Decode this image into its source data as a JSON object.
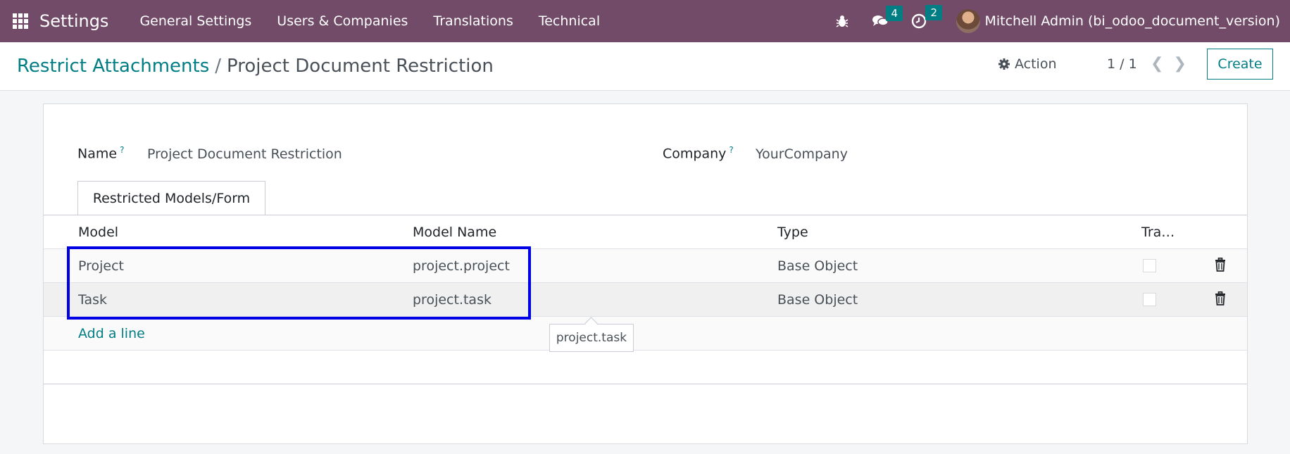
{
  "navbar": {
    "app_name": "Settings",
    "menu": [
      "General Settings",
      "Users & Companies",
      "Translations",
      "Technical"
    ],
    "messages_count": "4",
    "activities_count": "2",
    "user": "Mitchell Admin (bi_odoo_document_version)"
  },
  "breadcrumb": {
    "parent": "Restrict Attachments",
    "separator": "/",
    "current": "Project Document Restriction"
  },
  "control": {
    "action_label": "Action",
    "pager": "1 / 1",
    "create_label": "Create"
  },
  "form": {
    "name_label": "Name",
    "name_help": "?",
    "name_value": "Project Document Restriction",
    "company_label": "Company",
    "company_help": "?",
    "company_value": "YourCompany",
    "tab_label": "Restricted Models/Form"
  },
  "table": {
    "headers": [
      "Model",
      "Model Name",
      "Type",
      "Tra…"
    ],
    "rows": [
      {
        "model": "Project",
        "model_name": "project.project",
        "type": "Base Object"
      },
      {
        "model": "Task",
        "model_name": "project.task",
        "type": "Base Object"
      }
    ],
    "add_line": "Add a line"
  },
  "tooltip": "project.task",
  "colors": {
    "navbar": "#714b67",
    "accent": "#017e84",
    "highlight": "#0000e6"
  }
}
